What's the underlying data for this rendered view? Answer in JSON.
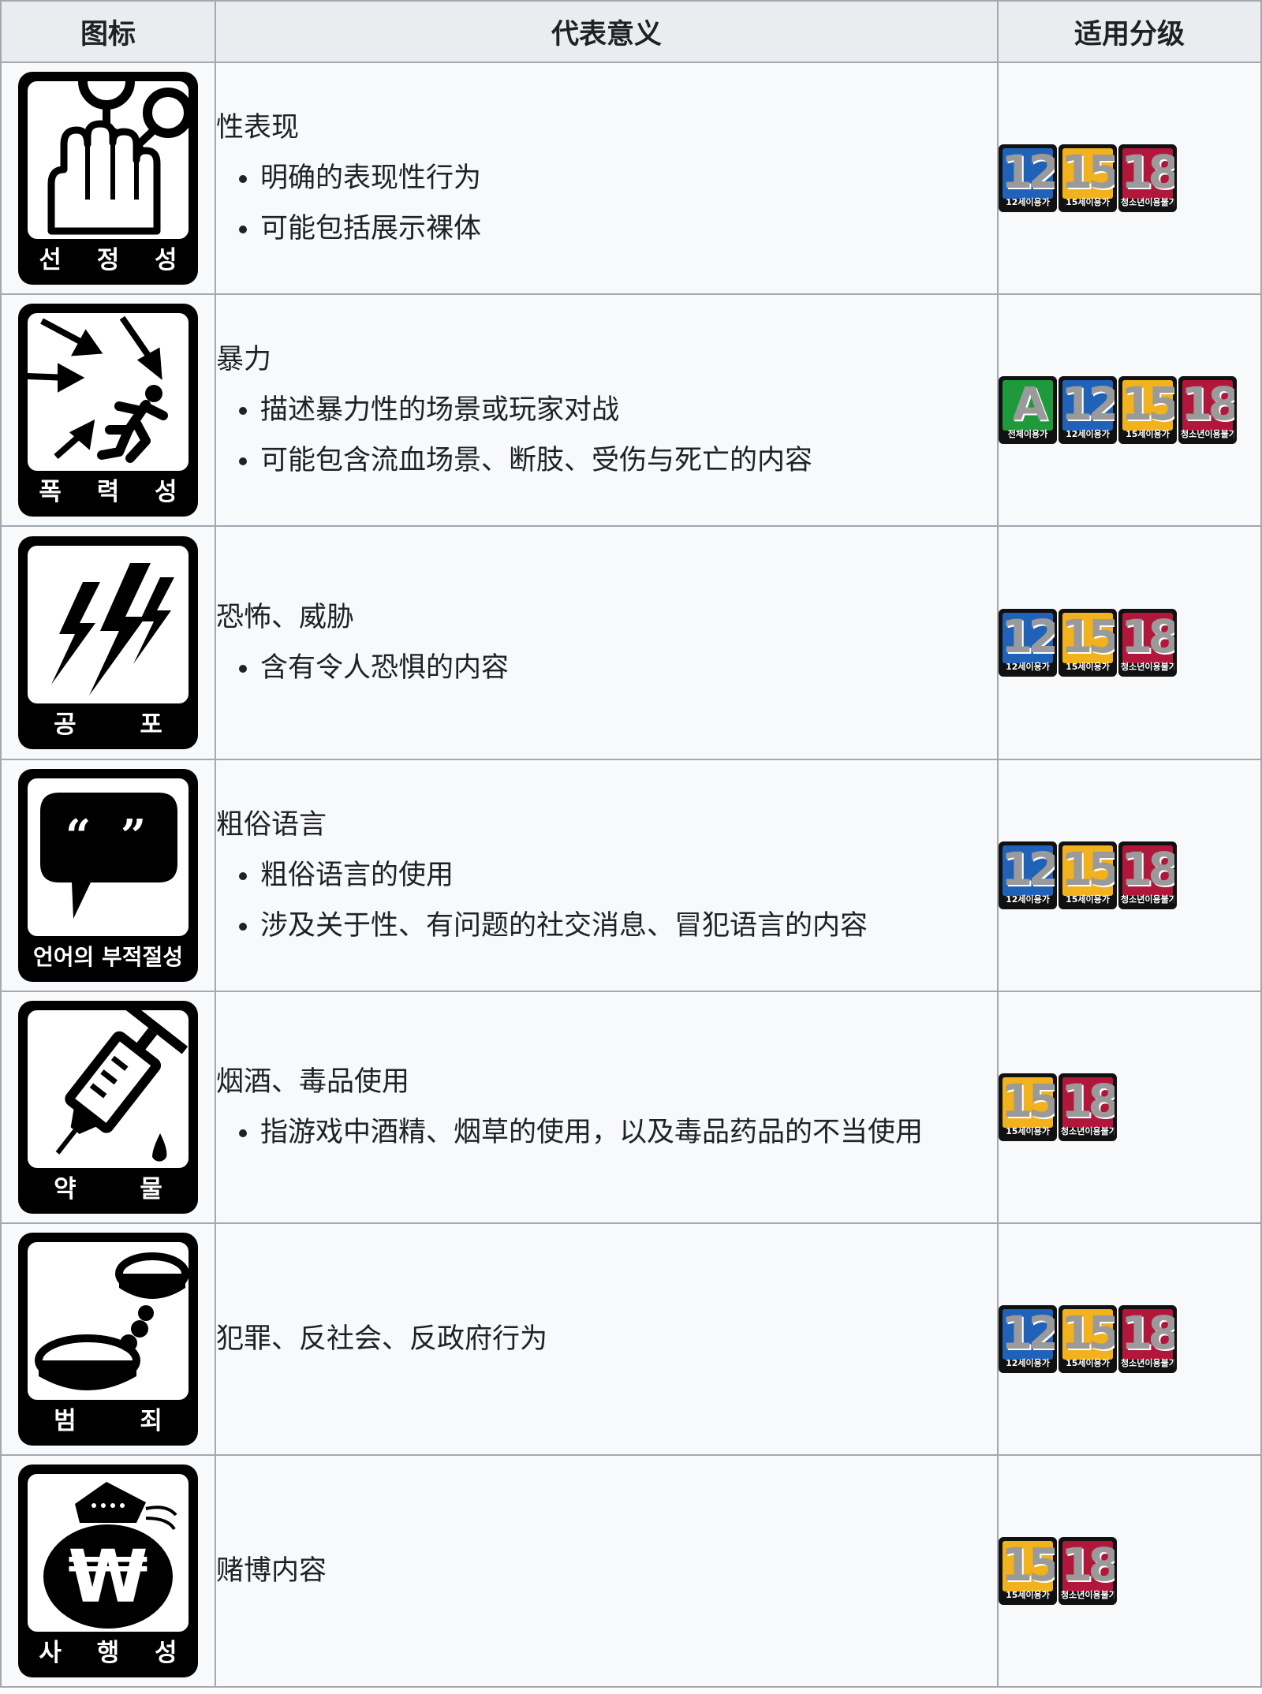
{
  "table": {
    "headers": {
      "icon": "图标",
      "meaning": "代表意义",
      "rating": "适用分级"
    },
    "rows": [
      {
        "icon": {
          "name": "sexuality-icon",
          "label": "선 정 성"
        },
        "title": "性表现",
        "points": [
          "明确的表现性行为",
          "可能包括展示裸体"
        ],
        "ratings": [
          "12",
          "15",
          "18"
        ]
      },
      {
        "icon": {
          "name": "violence-icon",
          "label": "폭 력 성"
        },
        "title": "暴力",
        "points": [
          "描述暴力性的场景或玩家对战",
          "可能包含流血场景、断肢、受伤与死亡的内容"
        ],
        "ratings": [
          "ALL",
          "12",
          "15",
          "18"
        ]
      },
      {
        "icon": {
          "name": "fear-icon",
          "label": "공 포"
        },
        "title": "恐怖、威胁",
        "points": [
          "含有令人恐惧的内容"
        ],
        "ratings": [
          "12",
          "15",
          "18"
        ]
      },
      {
        "icon": {
          "name": "language-icon",
          "label": "언어의 부적절성"
        },
        "title": "粗俗语言",
        "points": [
          "粗俗语言的使用",
          "涉及关于性、有问题的社交消息、冒犯语言的内容"
        ],
        "ratings": [
          "12",
          "15",
          "18"
        ]
      },
      {
        "icon": {
          "name": "drugs-icon",
          "label": "약 물"
        },
        "title": "烟酒、毒品使用",
        "points": [
          "指游戏中酒精、烟草的使用，以及毒品药品的不当使用"
        ],
        "ratings": [
          "15",
          "18"
        ]
      },
      {
        "icon": {
          "name": "crime-icon",
          "label": "범 죄"
        },
        "title": "犯罪、反社会、反政府行为",
        "points": [],
        "ratings": [
          "12",
          "15",
          "18"
        ]
      },
      {
        "icon": {
          "name": "gambling-icon",
          "label": "사 행 성"
        },
        "title": "赌博内容",
        "points": [],
        "ratings": [
          "15",
          "18"
        ]
      }
    ]
  },
  "rating_badges": {
    "ALL": {
      "numeral": "A",
      "caption": "전체이용가",
      "color": "#1e9a3c"
    },
    "12": {
      "numeral": "12",
      "caption": "12세이용가",
      "color": "#1f62b8"
    },
    "15": {
      "numeral": "15",
      "caption": "15세이용가",
      "color": "#f2b21e"
    },
    "18": {
      "numeral": "18",
      "caption": "청소년이용불가",
      "color": "#b0173b"
    }
  }
}
